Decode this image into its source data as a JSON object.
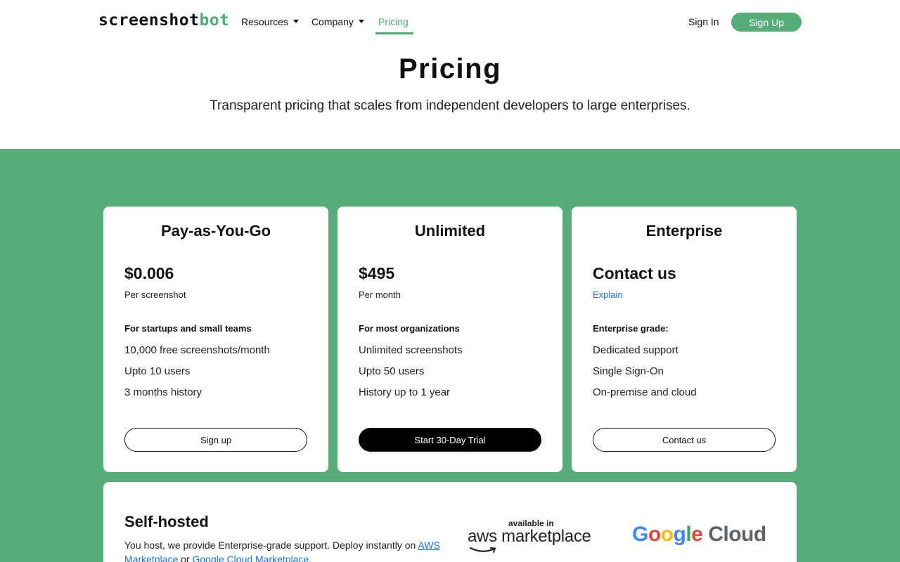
{
  "header": {
    "logo_main": "screenshot",
    "logo_accent": "bot",
    "nav": [
      {
        "label": "Resources",
        "has_dropdown": true
      },
      {
        "label": "Company",
        "has_dropdown": true
      },
      {
        "label": "Pricing",
        "active": true
      }
    ],
    "sign_in": "Sign In",
    "sign_up": "Sign Up"
  },
  "hero": {
    "title": "Pricing",
    "subtitle": "Transparent pricing that scales from independent developers to large enterprises."
  },
  "plans": [
    {
      "title": "Pay-as-You-Go",
      "price": "$0.006",
      "unit": "Per screenshot",
      "heading": "For startups and small teams",
      "features": [
        "10,000 free screenshots/month",
        "Upto 10 users",
        "3 months history"
      ],
      "button": "Sign up"
    },
    {
      "title": "Unlimited",
      "price": "$495",
      "unit": "Per month",
      "heading": "For most organizations",
      "features": [
        "Unlimited screenshots",
        "Upto 50 users",
        "History up to 1 year"
      ],
      "button": "Start 30-Day Trial"
    },
    {
      "title": "Enterprise",
      "price": "Contact us",
      "unit": "Explain",
      "heading": "Enterprise grade:",
      "features": [
        "Dedicated support",
        "Single Sign-On",
        "On-premise and cloud"
      ],
      "button": "Contact us"
    }
  ],
  "self_hosted": {
    "title": "Self-hosted",
    "text_before": "You host, we provide Enterprise-grade support. Deploy instantly on ",
    "link_aws": "AWS Marketplace",
    "text_or": " or ",
    "link_gcp": "Google Cloud Marketplace",
    "text_after": ".",
    "aws_logo_small": "available in",
    "aws_logo_main": "aws marketplace",
    "gcloud_logo": {
      "G": "G",
      "o1": "o",
      "o2": "o",
      "g": "g",
      "l": "l",
      "e": "e",
      "cloud": " Cloud"
    }
  },
  "colors": {
    "brand_green": "#56ad79",
    "link_blue": "#1a73d9"
  }
}
